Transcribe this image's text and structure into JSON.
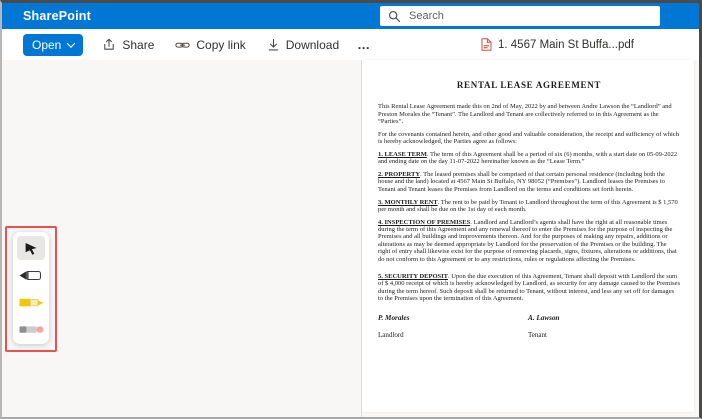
{
  "header": {
    "brand": "SharePoint",
    "search_placeholder": "Search"
  },
  "toolbar": {
    "open_label": "Open",
    "share_label": "Share",
    "copy_link_label": "Copy link",
    "download_label": "Download",
    "more_label": "…",
    "filename": "1. 4567 Main St Buffa...pdf"
  },
  "palette": {
    "selected_tool": "select-cursor",
    "tools": [
      "select-cursor",
      "pen",
      "highlighter",
      "eraser"
    ]
  },
  "document": {
    "title": "RENTAL LEASE AGREEMENT",
    "intro": [
      "This Rental Lease Agreement made this on 2nd of May, 2022 by and between Andre Lawson the “Landlord” and Preston Morales the “Tenant”. The Landlord and Tenant are collectively referred to in this Agreement as the “Parties”.",
      "For the covenants contained herein, and other good and valuable consideration, the receipt and sufficiency of which is hereby acknowledged, the Parties agree as follows:"
    ],
    "sections": [
      {
        "heading": "1. LEASE TERM",
        "body": ". The term of this Agreement shall be a period of six (6) months, with a start date on 05-09-2022 and ending date on the day 11-07-2022 hereinafter known as the “Lease Term.”"
      },
      {
        "heading": "2. PROPERTY",
        "body": ". The leased premises shall be comprised of that certain personal residence (including both the house and the land) located at 4567 Main St Buffalo, NY 98052 (“Premises”). Landlord leases the Premises to Tenant and Tenant leases the Premises from Landlord on the terms and conditions set forth herein."
      },
      {
        "heading": "3. MONTHLY RENT",
        "body": ". The rent to be paid by Tenant to Landlord throughout the term of this Agreement is $ 1,570 per month and shall be due on the 1st day of each month."
      },
      {
        "heading": "4. INSPECTION OF PREMISES",
        "body": ". Landlord and Landlord’s agents shall have the right at all reasonable times during the term of this Agreement and any renewal thereof to enter the Premises for the purpose of inspecting the Premises and all buildings and improvements thereon. And for the purposes of making any repairs, additions or alterations as may be deemed appropriate by Landlord for the preservation of the Premises or the building. The right of entry shall likewise exist for the purpose of removing placards, signs, fixtures, alterations or additions, that do not conform to this Agreement or to any restrictions, rules or regulations affecting the Premises."
      },
      {
        "heading": "5. SECURITY DEPOSIT",
        "body": ". Upon the due execution of this Agreement, Tenant shall deposit with Landlord the sum of $ 4,000 receipt of which is hereby acknowledged by Landlord, as security for any damage caused to the Premises during the term hereof. Such deposit shall be returned to Tenant, without interest, and less any set off for damages to the Premises upon the termination of this Agreement."
      }
    ],
    "signatures": {
      "left_name": "P. Morales",
      "right_name": "A. Lawson",
      "left_role": "Landlord",
      "right_role": "Tenant"
    }
  },
  "colors": {
    "accent": "#0077d4",
    "annotation": "#e8514d",
    "pdf_icon": "#c94f44"
  }
}
